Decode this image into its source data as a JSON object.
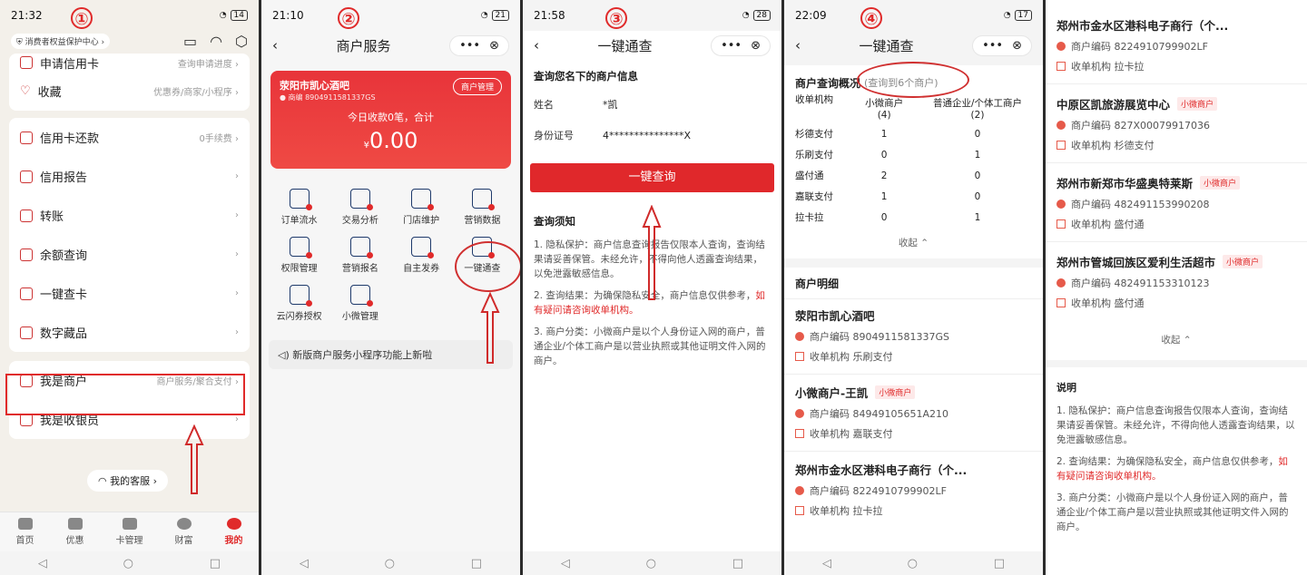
{
  "p1": {
    "num": "①",
    "time": "21:32",
    "batt": "14",
    "caps": "消费者权益保护中心",
    "rows": [
      {
        "label": "申请信用卡",
        "sub": "查询申请进度"
      },
      {
        "label": "收藏",
        "sub": "优惠券/商家/小程序"
      },
      {
        "label": "信用卡还款",
        "sub": "0手续费"
      },
      {
        "label": "信用报告",
        "sub": ""
      },
      {
        "label": "转账",
        "sub": ""
      },
      {
        "label": "余额查询",
        "sub": ""
      },
      {
        "label": "一键查卡",
        "sub": ""
      },
      {
        "label": "数字藏品",
        "sub": ""
      },
      {
        "label": "我是商户",
        "sub": "商户服务/聚合支付"
      },
      {
        "label": "我是收银员",
        "sub": ""
      }
    ],
    "service": "我的客服",
    "tabs": [
      "首页",
      "优惠",
      "卡管理",
      "财富",
      "我的"
    ]
  },
  "p2": {
    "num": "②",
    "time": "21:10",
    "batt": "21",
    "title": "商户服务",
    "shop": "荥阳市凯心酒吧",
    "code": "商编 8904911581337GS",
    "manage": "商户管理",
    "today": "今日收款0笔，合计",
    "amount": "0.00",
    "currency": "¥",
    "grid": [
      "订单流水",
      "交易分析",
      "门店维护",
      "营销数据",
      "权限管理",
      "营销报名",
      "自主发券",
      "一键通查",
      "云闪券授权",
      "小微管理"
    ],
    "notice": "新版商户服务小程序功能上新啦"
  },
  "p3": {
    "num": "③",
    "time": "21:58",
    "batt": "28",
    "title": "一键通查",
    "header": "查询您名下的商户信息",
    "name_k": "姓名",
    "name_v": "*凯",
    "id_k": "身份证号",
    "id_v": "4***************X",
    "btn": "一键查询",
    "notes_title": "查询须知",
    "n1": "1. 隐私保护：商户信息查询报告仅限本人查询，查询结果请妥善保管。未经允许，不得向他人透露查询结果，以免泄露敏感信息。",
    "n2a": "2. 查询结果：为确保隐私安全，商户信息仅供参考，",
    "n2b": "如有疑问请咨询收单机构。",
    "n3": "3. 商户分类：小微商户是以个人身份证入网的商户，普通企业/个体工商户是以营业执照或其他证明文件入网的商户。"
  },
  "p4": {
    "num": "④",
    "time": "22:09",
    "batt": "17",
    "title": "一键通查",
    "overview": "商户查询概况",
    "count": "(查询到6个商户)",
    "col1": "收单机构",
    "col2": "小微商户",
    "col2n": "(4)",
    "col3": "普通企业/个体工商户",
    "col3n": "(2)",
    "rows": [
      [
        "杉德支付",
        "1",
        "0"
      ],
      [
        "乐刷支付",
        "0",
        "1"
      ],
      [
        "盛付通",
        "2",
        "0"
      ],
      [
        "嘉联支付",
        "1",
        "0"
      ],
      [
        "拉卡拉",
        "0",
        "1"
      ]
    ],
    "collapse": "收起",
    "detail": "商户明细",
    "merchants": [
      {
        "name": "荥阳市凯心酒吧",
        "tag": "",
        "code": "商户编码 8904911581337GS",
        "org": "收单机构 乐刷支付"
      },
      {
        "name": "小微商户-王凯",
        "tag": "小微商户",
        "code": "商户编码 84949105651A210",
        "org": "收单机构 嘉联支付"
      },
      {
        "name": "郑州市金水区港科电子商行（个...",
        "tag": "",
        "code": "商户编码 8224910799902LF",
        "org": "收单机构 拉卡拉"
      }
    ]
  },
  "p5": {
    "merchants": [
      {
        "name": "郑州市金水区港科电子商行（个...",
        "tag": "",
        "code": "商户编码 8224910799902LF",
        "org": "收单机构 拉卡拉"
      },
      {
        "name": "中原区凯旅游展览中心",
        "tag": "小微商户",
        "code": "商户编码 827X00079917036",
        "org": "收单机构 杉德支付"
      },
      {
        "name": "郑州市新郑市华盛奥特莱斯",
        "tag": "小微商户",
        "code": "商户编码 482491153990208",
        "org": "收单机构 盛付通"
      },
      {
        "name": "郑州市管城回族区爱利生活超市",
        "tag": "小微商户",
        "code": "商户编码 482491153310123",
        "org": "收单机构 盛付通"
      }
    ],
    "collapse": "收起",
    "explain": "说明",
    "n1": "1. 隐私保护：商户信息查询报告仅限本人查询，查询结果请妥善保管。未经允许，不得向他人透露查询结果，以免泄露敏感信息。",
    "n2a": "2. 查询结果：为确保隐私安全，商户信息仅供参考，",
    "n2b": "如有疑问请咨询收单机构。",
    "n3": "3. 商户分类：小微商户是以个人身份证入网的商户，普通企业/个体工商户是以营业执照或其他证明文件入网的商户。"
  }
}
